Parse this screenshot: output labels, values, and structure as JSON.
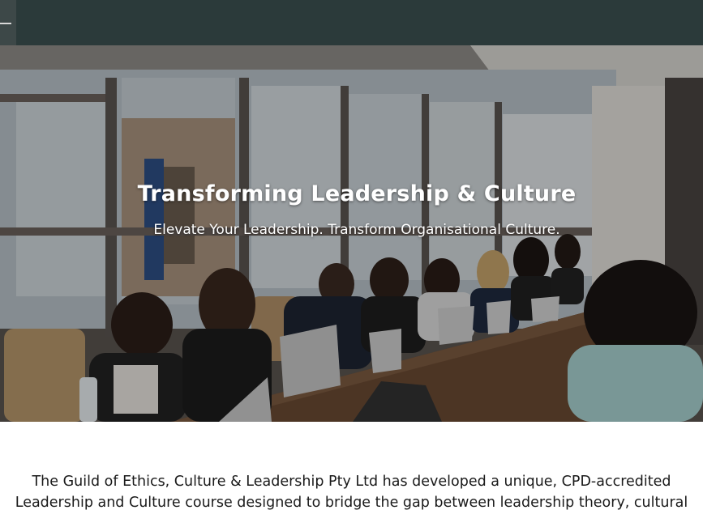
{
  "hero": {
    "title": "Transforming Leadership & Culture",
    "subtitle": "Elevate Your Leadership. Transform Organisational Culture.",
    "image_description": "people-around-conference-table-photo"
  },
  "intro": {
    "line1": "The Guild of Ethics, Culture & Leadership Pty Ltd has developed a unique, CPD-accredited",
    "line2": "Leadership and Culture course designed to bridge the gap between leadership theory, cultural"
  },
  "colors": {
    "top_bar": "#2b3a3a",
    "hero_text": "#ffffff",
    "body_text": "#1a1a1a"
  },
  "icons": {
    "menu": "hamburger-menu-icon"
  }
}
